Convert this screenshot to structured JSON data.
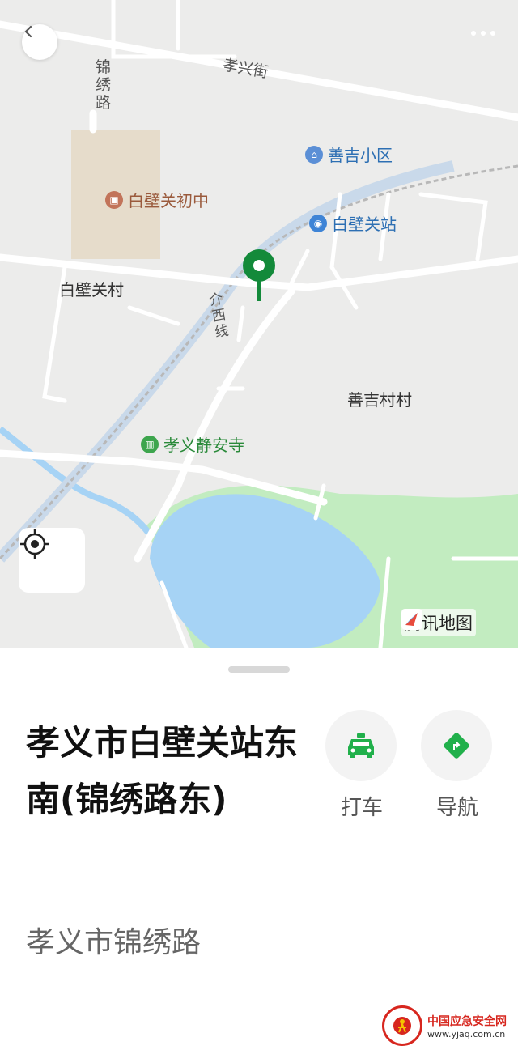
{
  "map": {
    "roads": {
      "xiaoxing_street": "孝兴街",
      "jinxiu_road": "锦绣路",
      "railway": "介西线"
    },
    "places": {
      "village": "白壁关村",
      "school": "白壁关初中",
      "community": "善吉小区",
      "station": "白壁关站",
      "village2": "善吉村村",
      "temple": "孝义静安寺"
    },
    "brand": "腾讯地图",
    "icons": {
      "back": "chevron-left-icon",
      "more": "more-dots-icon",
      "locate": "crosshair-icon",
      "pin": "map-pin-icon"
    },
    "colors": {
      "pin": "#138a3a",
      "water": "#a6d3f5",
      "park": "#c2ecc0",
      "land": "#ececeb"
    }
  },
  "place": {
    "title": "孝义市白壁关站东南(锦绣路东)",
    "address": "孝义市锦绣路"
  },
  "actions": [
    {
      "label": "打车",
      "icon": "taxi-icon",
      "color": "#21b04b"
    },
    {
      "label": "导航",
      "icon": "navigation-icon",
      "color": "#21b04b"
    }
  ],
  "watermark": {
    "name": "中国应急安全网",
    "url": "www.yjaq.com.cn"
  }
}
